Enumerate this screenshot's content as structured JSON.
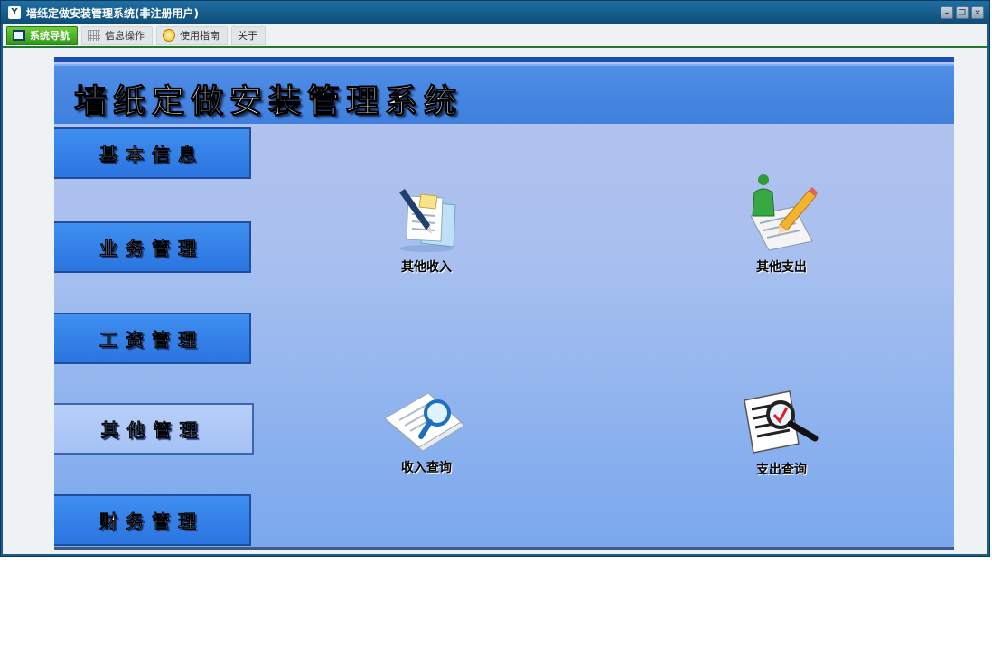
{
  "window": {
    "title": "墙纸定做安装管理系统(非注册用户)",
    "app_icon_glyph": "Y"
  },
  "menu": {
    "tabs": [
      {
        "label": "系统导航",
        "icon": "monitor-icon",
        "active": true
      },
      {
        "label": "信息操作",
        "icon": "grid-icon",
        "active": false
      },
      {
        "label": "使用指南",
        "icon": "help-icon",
        "active": false
      },
      {
        "label": "关于",
        "icon": "",
        "active": false
      }
    ]
  },
  "header": {
    "title": "墙纸定做安装管理系统"
  },
  "sidebar": {
    "items": [
      {
        "label": "基本信息",
        "selected": false
      },
      {
        "label": "业务管理",
        "selected": false
      },
      {
        "label": "工资管理",
        "selected": false
      },
      {
        "label": "其他管理",
        "selected": true
      },
      {
        "label": "财务管理",
        "selected": false
      }
    ]
  },
  "functions": [
    {
      "label": "其他收入",
      "icon": "document-pen-icon"
    },
    {
      "label": "其他支出",
      "icon": "user-pencil-icon"
    },
    {
      "label": "收入查询",
      "icon": "document-search-icon"
    },
    {
      "label": "支出查询",
      "icon": "checklist-search-icon"
    }
  ],
  "colors": {
    "active_tab": "#3aa820",
    "header_blue": "#4685e2",
    "nav_blue": "#2f7de6",
    "nav_selected": "#a9c6f6"
  }
}
